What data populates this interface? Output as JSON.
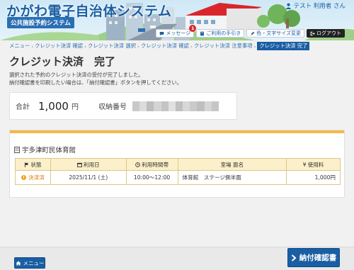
{
  "header": {
    "site_title": "かがわ電子自治体システム",
    "site_subtitle": "公共施設予約システム",
    "user_name": "テスト 利用者 さん",
    "buttons": {
      "message": "メッセージ",
      "message_badge": "1",
      "guide": "ご利用の手引き",
      "display": "色・文字サイズ変更",
      "logout": "ログアウト"
    }
  },
  "breadcrumb": [
    "メニュー",
    "クレジット決済 確認",
    "クレジット決済 選択",
    "クレジット決済 確認",
    "クレジット決済 注意事項",
    "クレジット決済 完了"
  ],
  "page": {
    "title": "クレジット決済　完了",
    "message_line1": "選択された予約のクレジット決済の受付が完了しました。",
    "message_line2": "納付確認書を印刷したい場合は、「納付確認書」ボタンを押してください。"
  },
  "summary": {
    "total_label": "合計",
    "total_amount": "1,000",
    "total_unit": "円",
    "receipt_label": "収納番号"
  },
  "facility": {
    "name": "宇多津町民体育館",
    "columns": {
      "status": "状態",
      "date": "利用日",
      "time": "利用時間帯",
      "room": "室場 面名",
      "fee": "使用料"
    },
    "rows": [
      {
        "status": "決済済",
        "date": "2025/11/1 (土)",
        "time": "10:00～12:00",
        "room": "体育館　ステージ側半面",
        "fee": "1,000円"
      }
    ]
  },
  "footer": {
    "menu_button": "メニュー",
    "receipt_button": "納付確認書"
  },
  "colors": {
    "primary": "#1a5ea3",
    "accent_yellow": "#f4b942",
    "table_header": "#fbf0c9",
    "status_orange": "#d97a00",
    "badge_red": "#d9262d"
  }
}
